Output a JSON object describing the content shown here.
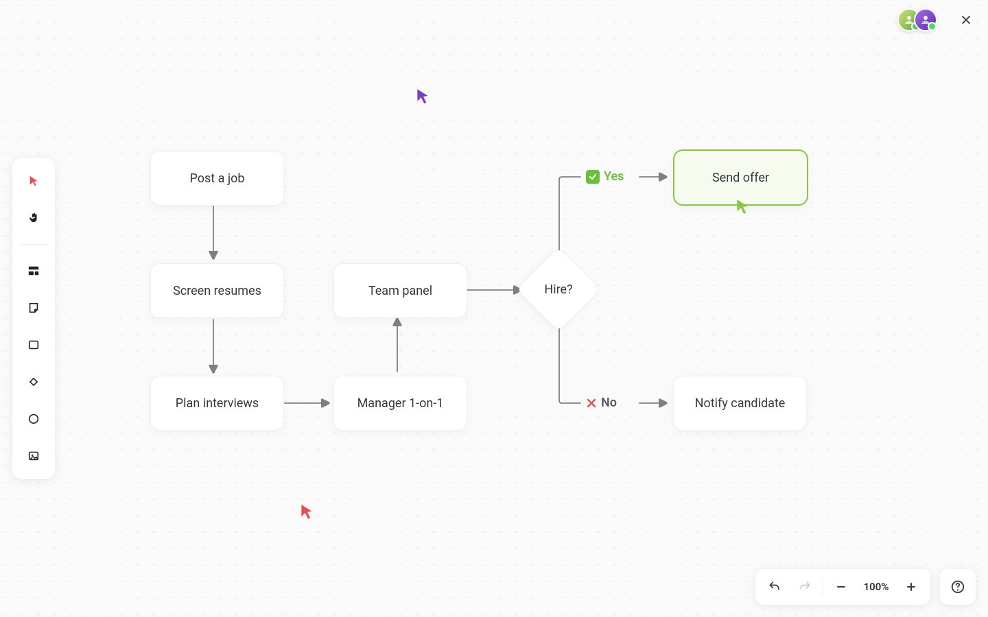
{
  "chart_data": {
    "type": "flowchart",
    "title": "",
    "nodes": [
      {
        "id": "post",
        "type": "process",
        "label": "Post a job"
      },
      {
        "id": "screen",
        "type": "process",
        "label": "Screen resumes"
      },
      {
        "id": "plan",
        "type": "process",
        "label": "Plan interviews"
      },
      {
        "id": "mgr",
        "type": "process",
        "label": "Manager 1-on-1"
      },
      {
        "id": "team",
        "type": "process",
        "label": "Team panel"
      },
      {
        "id": "hire",
        "type": "decision",
        "label": "Hire?"
      },
      {
        "id": "offer",
        "type": "process",
        "label": "Send offer",
        "selected": true
      },
      {
        "id": "notify",
        "type": "process",
        "label": "Notify candidate"
      }
    ],
    "edges": [
      {
        "from": "post",
        "to": "screen"
      },
      {
        "from": "screen",
        "to": "plan"
      },
      {
        "from": "plan",
        "to": "mgr"
      },
      {
        "from": "mgr",
        "to": "team"
      },
      {
        "from": "team",
        "to": "hire"
      },
      {
        "from": "hire",
        "to": "offer",
        "label": "Yes"
      },
      {
        "from": "hire",
        "to": "notify",
        "label": "No"
      }
    ]
  },
  "branches": {
    "yes": "Yes",
    "no": "No"
  },
  "toolbar": {
    "items": [
      {
        "id": "select",
        "icon": "cursor-icon",
        "active": true
      },
      {
        "id": "hand",
        "icon": "hand-icon"
      },
      {
        "id": "section",
        "icon": "section-icon"
      },
      {
        "id": "sticky",
        "icon": "sticky-note-icon"
      },
      {
        "id": "rect",
        "icon": "rectangle-icon"
      },
      {
        "id": "diamond",
        "icon": "diamond-icon"
      },
      {
        "id": "circle",
        "icon": "circle-icon"
      },
      {
        "id": "image",
        "icon": "image-icon"
      }
    ]
  },
  "collaborators": {
    "avatars": [
      {
        "id": "u1",
        "color": "avatar-1",
        "online": true
      },
      {
        "id": "u2",
        "color": "avatar-2",
        "online": true
      }
    ]
  },
  "cursors": [
    {
      "id": "purple",
      "color": "#7a3cc9"
    },
    {
      "id": "red",
      "color": "#e84e4e"
    },
    {
      "id": "green",
      "color": "#8bc540"
    }
  ],
  "zoom": {
    "value": "100%"
  }
}
